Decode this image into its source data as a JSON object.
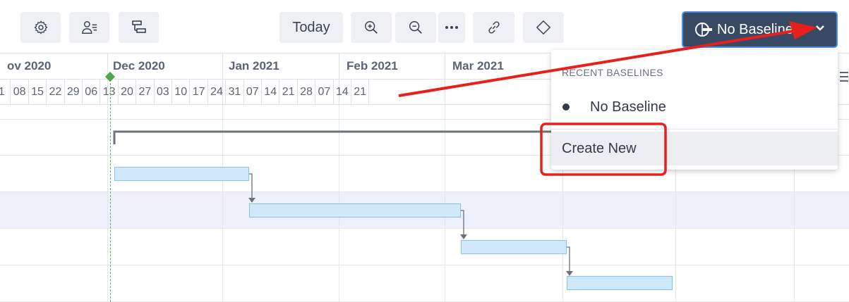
{
  "toolbar": {
    "settings_icon": "gear-icon",
    "assign_icon": "user-list-icon",
    "group_icon": "outline-icon",
    "today_label": "Today",
    "zoom_in_icon": "zoom-in-icon",
    "zoom_out_icon": "zoom-out-icon",
    "more_icon": "more-icon",
    "link_icon": "link-icon",
    "milestone_icon": "diamond-icon",
    "baseline_label": "No Baseline",
    "baseline_icon": "baseline-icon"
  },
  "timescale": {
    "months": [
      "ov 2020",
      "Dec 2020",
      "Jan 2021",
      "Feb 2021",
      "Mar 2021"
    ],
    "weeks": [
      "1",
      "08",
      "15",
      "22",
      "29",
      "06",
      "13",
      "20",
      "27",
      "03",
      "10",
      "17",
      "24",
      "31",
      "07",
      "14",
      "21",
      "28",
      "07",
      "14",
      "21"
    ]
  },
  "dropdown": {
    "header": "RECENT BASELINES",
    "items": [
      "No Baseline"
    ],
    "create_label": "Create New"
  },
  "colors": {
    "accent": "#384a63",
    "bar_fill": "#cfe9fb",
    "highlight_row": "#eef1fb",
    "today_marker": "#4aa84a",
    "annotation": "#e8201c"
  }
}
